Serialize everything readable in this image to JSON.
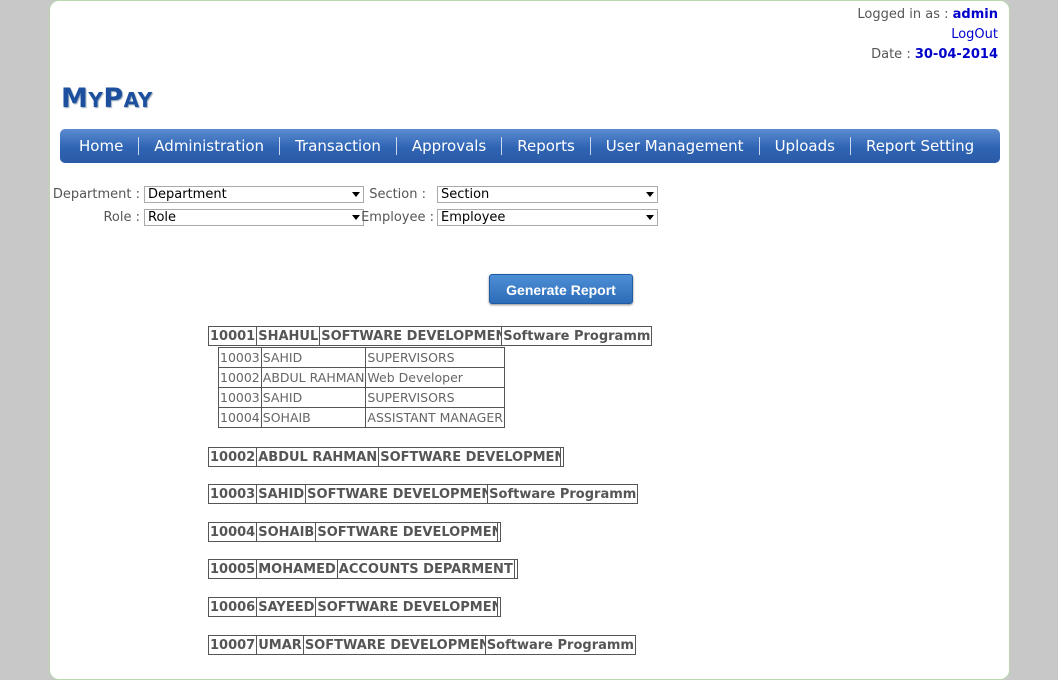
{
  "header": {
    "logged_in_label": "Logged in as :",
    "username": "admin",
    "logout": "LogOut",
    "date_label": "Date :",
    "date": "30-04-2014"
  },
  "logo": {
    "cap1": "M",
    "rest1": "Y",
    "cap2": "P",
    "rest2": "AY"
  },
  "nav": [
    "Home",
    "Administration",
    "Transaction",
    "Approvals",
    "Reports",
    "User Management",
    "Uploads",
    "Report Setting"
  ],
  "filters": {
    "department_label": "Department :",
    "department_value": "Department",
    "section_label": "Section :",
    "section_value": "Section",
    "role_label": "Role :",
    "role_value": "Role",
    "employee_label": "Employee :",
    "employee_value": "Employee"
  },
  "generate_button": "Generate Report",
  "employees": [
    {
      "id": "10001",
      "name": "SHAHUL",
      "dept": "SOFTWARE DEVELOPMENT",
      "desig": "Software Programm",
      "subordinates": [
        {
          "id": "10003",
          "name": "SAHID",
          "desig": "SUPERVISORS"
        },
        {
          "id": "10002",
          "name": "ABDUL RAHMAN",
          "desig": "Web Developer"
        },
        {
          "id": "10003",
          "name": "SAHID",
          "desig": "SUPERVISORS"
        },
        {
          "id": "10004",
          "name": "SOHAIB",
          "desig": "ASSISTANT MANAGER"
        }
      ]
    },
    {
      "id": "10002",
      "name": "ABDUL RAHMAN",
      "dept": "SOFTWARE DEVELOPMENT",
      "desig": ""
    },
    {
      "id": "10003",
      "name": "SAHID",
      "dept": "SOFTWARE DEVELOPMENT",
      "desig": "Software Programm"
    },
    {
      "id": "10004",
      "name": "SOHAIB",
      "dept": "SOFTWARE DEVELOPMENT",
      "desig": ""
    },
    {
      "id": "10005",
      "name": "MOHAMED",
      "dept": "ACCOUNTS DEPARMENT",
      "desig": ""
    },
    {
      "id": "10006",
      "name": "SAYEED",
      "dept": "SOFTWARE DEVELOPMENT",
      "desig": ""
    },
    {
      "id": "10007",
      "name": "UMAR",
      "dept": "SOFTWARE DEVELOPMENT",
      "desig": "Software Programm"
    }
  ]
}
